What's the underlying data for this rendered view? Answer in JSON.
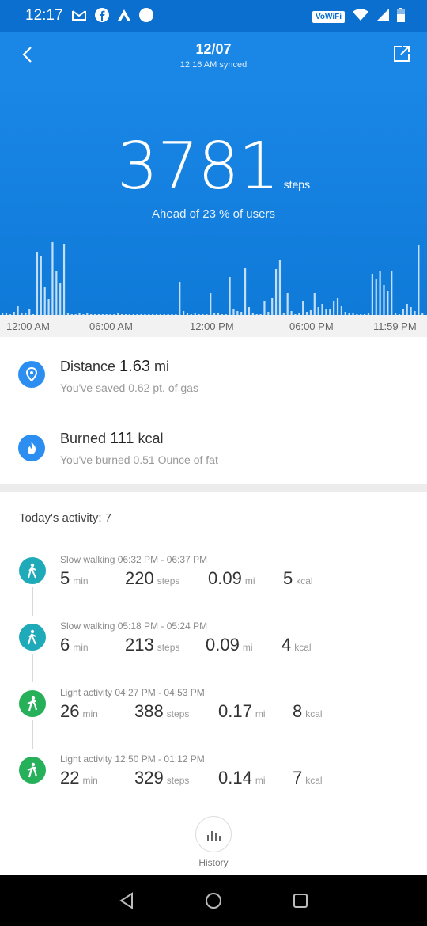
{
  "status_bar": {
    "time": "12:17",
    "carrier_badge": "VoWiFi"
  },
  "header": {
    "date": "12/07",
    "synced": "12:16 AM synced"
  },
  "hero": {
    "steps": "3781",
    "steps_unit": "steps",
    "ahead": "Ahead of 23 % of users"
  },
  "chart_data": {
    "type": "bar",
    "title": "",
    "x_ticks": [
      "12:00 AM",
      "06:00 AM",
      "12:00 PM",
      "06:00 PM",
      "11:59 PM"
    ],
    "values": [
      2,
      3,
      1,
      4,
      12,
      3,
      2,
      8,
      1,
      80,
      75,
      35,
      20,
      92,
      55,
      40,
      90,
      3,
      1,
      1,
      2,
      1,
      2,
      1,
      1,
      1,
      1,
      1,
      1,
      1,
      2,
      1,
      1,
      1,
      1,
      1,
      1,
      1,
      1,
      1,
      1,
      1,
      1,
      1,
      1,
      1,
      42,
      5,
      2,
      1,
      2,
      1,
      1,
      1,
      28,
      3,
      2,
      1,
      1,
      48,
      8,
      5,
      4,
      60,
      10,
      2,
      1,
      1,
      18,
      4,
      22,
      58,
      70,
      3,
      28,
      5,
      1,
      2,
      18,
      4,
      6,
      28,
      10,
      14,
      8,
      8,
      18,
      22,
      12,
      4,
      3,
      2,
      1,
      1,
      1,
      2,
      52,
      45,
      55,
      38,
      30,
      55,
      2,
      1,
      8,
      14,
      10,
      5,
      88,
      2
    ]
  },
  "time_axis": [
    "12:00 AM",
    "06:00 AM",
    "12:00 PM",
    "06:00 PM",
    "11:59 PM"
  ],
  "distance": {
    "label": "Distance",
    "value": "1.63",
    "unit": "mi",
    "sub": "You've saved 0.62 pt.  of gas",
    "icon": "location-pin-icon"
  },
  "burned": {
    "label": "Burned",
    "value": "111",
    "unit": "kcal",
    "sub": "You've burned 0.51 Ounce  of fat",
    "icon": "flame-icon"
  },
  "today": {
    "label": "Today's activity:  7"
  },
  "activities": [
    {
      "title": "Slow walking 06:32 PM - 06:37 PM",
      "min": "5",
      "steps": "220",
      "mi": "0.09",
      "kcal": "5",
      "color": "#1eaab8",
      "icon": "walking-icon"
    },
    {
      "title": "Slow walking 05:18 PM - 05:24 PM",
      "min": "6",
      "steps": "213",
      "mi": "0.09",
      "kcal": "4",
      "color": "#1eaab8",
      "icon": "walking-icon"
    },
    {
      "title": "Light activity 04:27 PM - 04:53 PM",
      "min": "26",
      "steps": "388",
      "mi": "0.17",
      "kcal": "8",
      "color": "#26b05a",
      "icon": "light-activity-icon"
    },
    {
      "title": "Light activity 12:50 PM - 01:12 PM",
      "min": "22",
      "steps": "329",
      "mi": "0.14",
      "kcal": "7",
      "color": "#26b05a",
      "icon": "light-activity-icon"
    }
  ],
  "units": {
    "min": "min",
    "steps": "steps",
    "mi": "mi",
    "kcal": "kcal"
  },
  "bottom": {
    "history": "History"
  }
}
